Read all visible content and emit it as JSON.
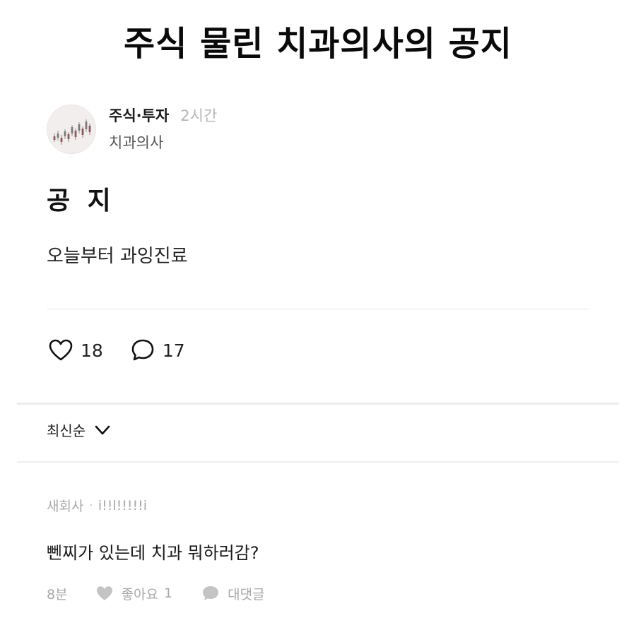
{
  "headline": "주식 물린 치과의사의 공지",
  "post": {
    "category": "주식·투자",
    "time": "2시간",
    "author": "치과의사",
    "title": "공 지",
    "body": "오늘부터 과잉진료",
    "likes": "18",
    "comments": "17"
  },
  "sort": {
    "label": "최신순"
  },
  "comment": {
    "company": "새회사",
    "nickname": "i!!l!!!!!i",
    "text": "뻰찌가 있는데 치과 뭐하러감?",
    "time": "8분",
    "like_label": "좋아요",
    "like_count": "1",
    "reply_label": "대댓글"
  },
  "icons": {
    "avatar": "stock-chart-avatar-icon",
    "like": "heart-icon",
    "comment": "speech-bubble-icon",
    "sort": "chevron-down-icon"
  },
  "colors": {
    "muted_text": "#a8a8a8",
    "divider": "#e8e8e8"
  }
}
